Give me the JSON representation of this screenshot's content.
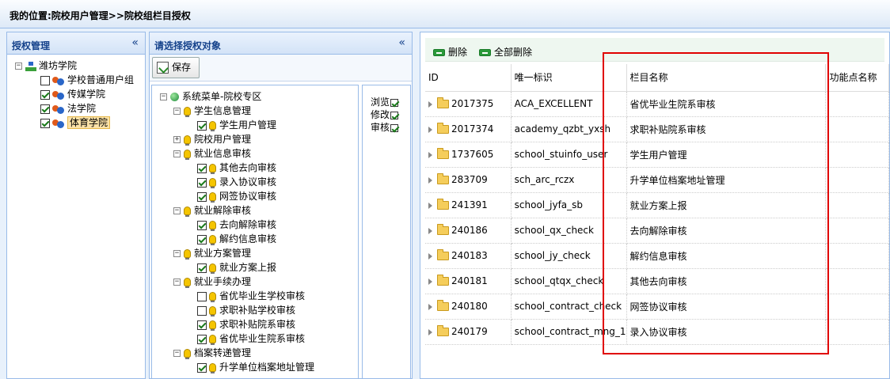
{
  "breadcrumb": "我的位置:院校用户管理>>院校组栏目授权",
  "left_panel": {
    "title": "授权管理",
    "collapse_glyph": "«",
    "root": "潍坊学院",
    "items": [
      {
        "label": "学校普通用户组",
        "checked": false,
        "selected": false
      },
      {
        "label": "传媒学院",
        "checked": true,
        "selected": false
      },
      {
        "label": "法学院",
        "checked": true,
        "selected": false
      },
      {
        "label": "体育学院",
        "checked": true,
        "selected": true
      }
    ]
  },
  "middle_panel": {
    "title": "请选择授权对象",
    "collapse_glyph": "«",
    "save_label": "保存",
    "tree": [
      {
        "label": "系统菜单-院校专区",
        "level": 0,
        "expander": "−",
        "icon": "globe-icon"
      },
      {
        "label": "学生信息管理",
        "level": 1,
        "expander": "−",
        "icon": "bulb-icon"
      },
      {
        "label": "学生用户管理",
        "level": 2,
        "checked": true,
        "icon": "bulb-icon"
      },
      {
        "label": "院校用户管理",
        "level": 1,
        "expander": "+",
        "icon": "bulb-icon"
      },
      {
        "label": "就业信息审核",
        "level": 1,
        "expander": "−",
        "icon": "bulb-icon"
      },
      {
        "label": "其他去向审核",
        "level": 2,
        "checked": true,
        "icon": "bulb-icon"
      },
      {
        "label": "录入协议审核",
        "level": 2,
        "checked": true,
        "icon": "bulb-icon"
      },
      {
        "label": "网签协议审核",
        "level": 2,
        "checked": true,
        "icon": "bulb-icon"
      },
      {
        "label": "就业解除审核",
        "level": 1,
        "expander": "−",
        "icon": "bulb-icon"
      },
      {
        "label": "去向解除审核",
        "level": 2,
        "checked": true,
        "icon": "bulb-icon"
      },
      {
        "label": "解约信息审核",
        "level": 2,
        "checked": true,
        "icon": "bulb-icon"
      },
      {
        "label": "就业方案管理",
        "level": 1,
        "expander": "−",
        "icon": "bulb-icon"
      },
      {
        "label": "就业方案上报",
        "level": 2,
        "checked": true,
        "icon": "bulb-icon"
      },
      {
        "label": "就业手续办理",
        "level": 1,
        "expander": "−",
        "icon": "bulb-icon"
      },
      {
        "label": "省优毕业生学校审核",
        "level": 2,
        "checked": false,
        "icon": "bulb-icon"
      },
      {
        "label": "求职补贴学校审核",
        "level": 2,
        "checked": false,
        "icon": "bulb-icon"
      },
      {
        "label": "求职补贴院系审核",
        "level": 2,
        "checked": true,
        "icon": "bulb-icon"
      },
      {
        "label": "省优毕业生院系审核",
        "level": 2,
        "checked": true,
        "icon": "bulb-icon"
      },
      {
        "label": "档案转递管理",
        "level": 1,
        "expander": "−",
        "icon": "bulb-icon"
      },
      {
        "label": "升学单位档案地址管理",
        "level": 2,
        "checked": true,
        "icon": "bulb-icon"
      }
    ],
    "permissions": [
      {
        "label": "浏览",
        "checked": true
      },
      {
        "label": "修改",
        "checked": true
      },
      {
        "label": "审核",
        "checked": true
      }
    ]
  },
  "grid": {
    "delete_label": "删除",
    "delete_all_label": "全部删除",
    "columns": [
      "ID",
      "唯一标识",
      "栏目名称",
      "功能点名称"
    ],
    "rows": [
      {
        "id": "2017375",
        "key": "ACA_EXCELLENT",
        "name": "省优毕业生院系审核"
      },
      {
        "id": "2017374",
        "key": "academy_qzbt_yxsh",
        "name": "求职补贴院系审核"
      },
      {
        "id": "1737605",
        "key": "school_stuinfo_user",
        "name": "学生用户管理"
      },
      {
        "id": "283709",
        "key": "sch_arc_rczx",
        "name": "升学单位档案地址管理"
      },
      {
        "id": "241391",
        "key": "school_jyfa_sb",
        "name": "就业方案上报"
      },
      {
        "id": "240186",
        "key": "school_qx_check",
        "name": "去向解除审核"
      },
      {
        "id": "240183",
        "key": "school_jy_check",
        "name": "解约信息审核"
      },
      {
        "id": "240181",
        "key": "school_qtqx_check",
        "name": "其他去向审核"
      },
      {
        "id": "240180",
        "key": "school_contract_check",
        "name": "网签协议审核"
      },
      {
        "id": "240179",
        "key": "school_contract_mng_1",
        "name": "录入协议审核"
      }
    ]
  },
  "colors": {
    "accent": "#15428b",
    "highlight": "#e00000",
    "panel_border": "#99bbe8"
  }
}
